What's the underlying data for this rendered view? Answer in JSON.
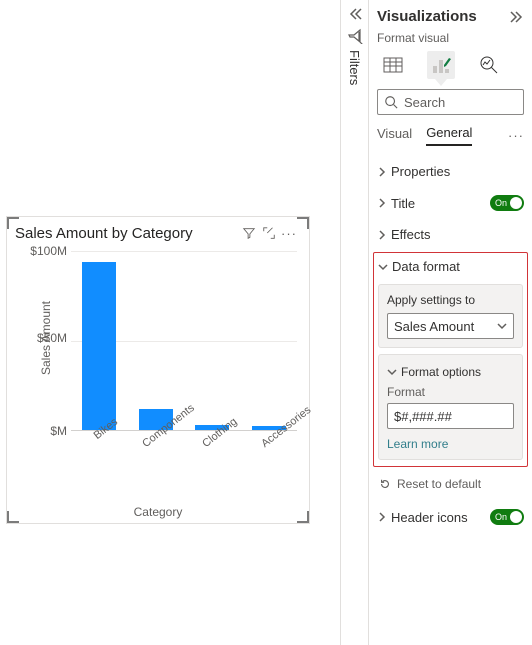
{
  "filters_label": "Filters",
  "pane": {
    "title": "Visualizations",
    "subtitle": "Format visual",
    "search_placeholder": "Search",
    "tabs": {
      "visual": "Visual",
      "general": "General"
    },
    "sections": {
      "properties": "Properties",
      "title": "Title",
      "effects": "Effects",
      "data_format": "Data format",
      "header_icons": "Header icons"
    },
    "toggle_on": "On",
    "apply_settings_to": "Apply settings to",
    "apply_field": "Sales Amount",
    "format_options": "Format options",
    "format_label": "Format",
    "format_value": "$#,###.##",
    "learn_more": "Learn more",
    "reset": "Reset to default"
  },
  "chart": {
    "title": "Sales Amount by Category",
    "ylabel": "Sales Amount",
    "xlabel": "Category",
    "yticks": [
      "$100M",
      "$50M",
      "$M"
    ]
  },
  "chart_data": {
    "type": "bar",
    "title": "Sales Amount by Category",
    "xlabel": "Category",
    "ylabel": "Sales Amount",
    "ylim": [
      0,
      100
    ],
    "y_unit": "M (millions, USD)",
    "categories": [
      "Bikes",
      "Components",
      "Clothing",
      "Accessories"
    ],
    "values": [
      94,
      12,
      3,
      2
    ]
  }
}
